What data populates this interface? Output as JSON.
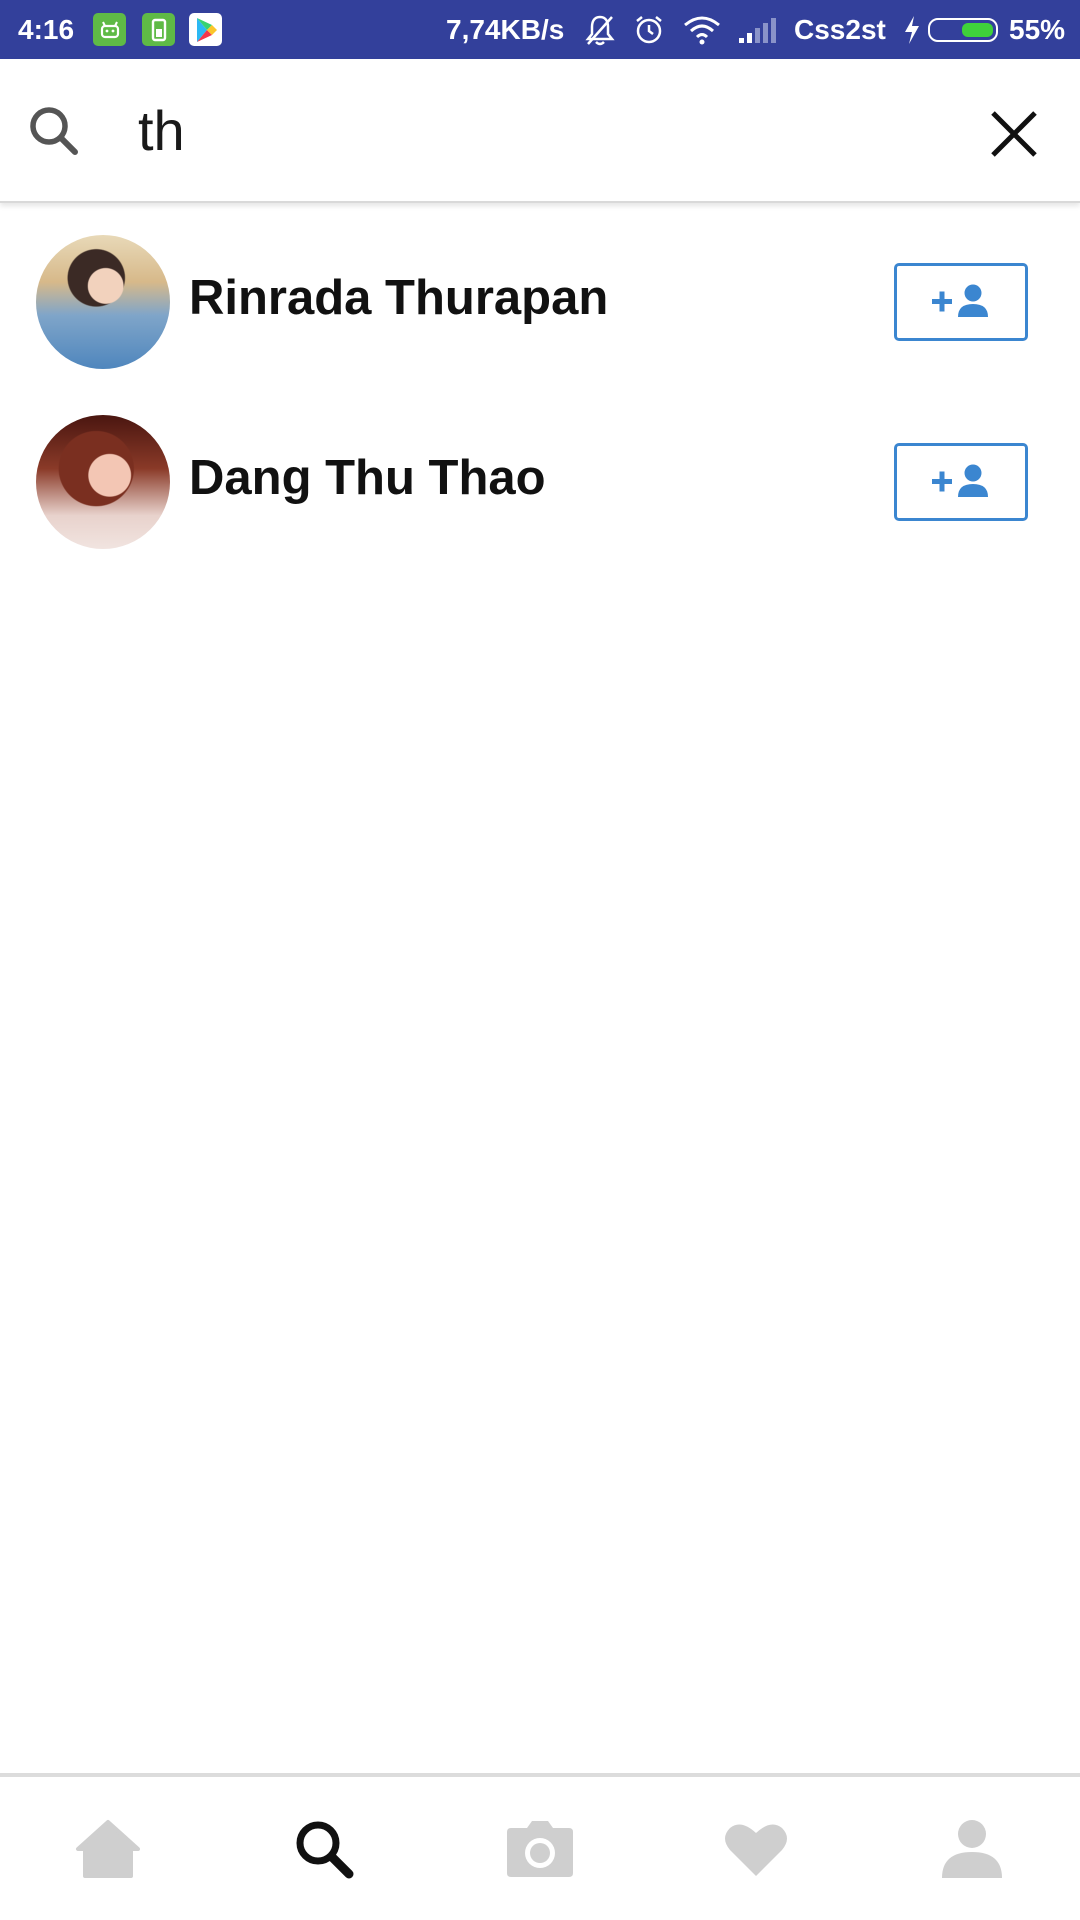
{
  "status_bar": {
    "time": "4:16",
    "network_speed": "7,74KB/s",
    "carrier": "Css2st",
    "battery_percent": "55%",
    "battery_level": 0.55,
    "icons": [
      "android-app-icon",
      "battery-app-icon",
      "play-store-icon",
      "bell-off-icon",
      "alarm-icon",
      "wifi-icon",
      "signal-icon",
      "charging-bolt-icon",
      "battery-icon"
    ]
  },
  "search": {
    "query": "th",
    "icons": [
      "search-icon",
      "close-icon"
    ]
  },
  "results": [
    {
      "name": "Rinrada Thurapan",
      "action_icon": "add-person-icon"
    },
    {
      "name": "Dang Thu Thao",
      "action_icon": "add-person-icon"
    }
  ],
  "bottom_nav": {
    "items": [
      {
        "icon": "home-icon",
        "active": false
      },
      {
        "icon": "search-icon",
        "active": true
      },
      {
        "icon": "camera-icon",
        "active": false
      },
      {
        "icon": "heart-icon",
        "active": false
      },
      {
        "icon": "person-icon",
        "active": false
      }
    ]
  },
  "colors": {
    "status_bar": "#33409b",
    "accent_blue": "#3b86d0",
    "nav_inactive": "#cfcfcf",
    "nav_active": "#111111",
    "battery_green": "#3fd13a"
  }
}
